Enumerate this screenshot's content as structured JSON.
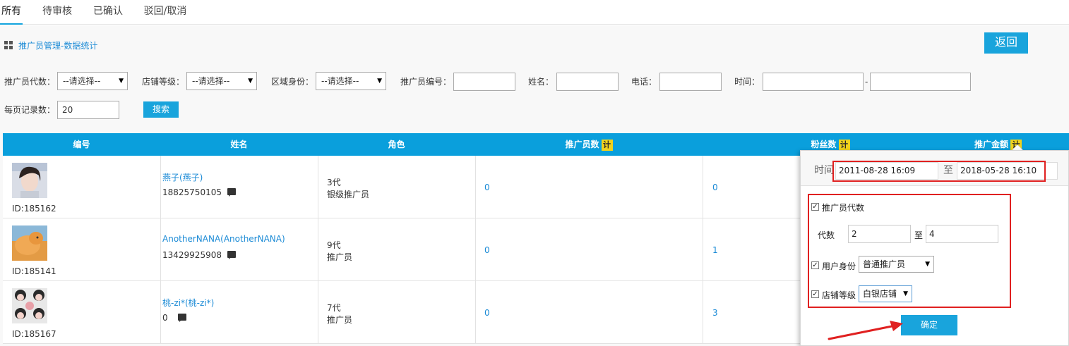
{
  "tabs": [
    {
      "label": "所有"
    },
    {
      "label": "待审核"
    },
    {
      "label": "已确认"
    },
    {
      "label": "驳回/取消"
    }
  ],
  "breadcrumb": "推广员管理-数据统计",
  "back_button": "返回",
  "filters": {
    "level_label": "推广员代数：",
    "level_value": "--请选择--",
    "shop_label": "店铺等级：",
    "shop_value": "--请选择--",
    "region_label": "区域身份：",
    "region_value": "--请选择--",
    "code_label": "推广员编号：",
    "name_label": "姓名：",
    "phone_label": "电话：",
    "time_label": "时间：",
    "time_dash": "-",
    "page_size_label": "每页记录数：",
    "page_size_value": "20",
    "search_button": "搜索"
  },
  "table": {
    "headers": [
      "编号",
      "姓名",
      "角色",
      "推广员数",
      "粉丝数",
      "推广金额"
    ],
    "calc_icon_glyph": "计",
    "rows": [
      {
        "id": "ID:185162",
        "name": "燕子(燕子)",
        "phone": "18825750105",
        "generation": "3代",
        "role": "银级推广员",
        "promoters": "0",
        "fans": "0"
      },
      {
        "id": "ID:185141",
        "name": "AnotherNANA(AnotherNANA)",
        "phone": "13429925908",
        "generation": "9代",
        "role": "推广员",
        "promoters": "0",
        "fans": "1"
      },
      {
        "id": "ID:185167",
        "name": "桃-zi*(桃-zi*)",
        "phone": "0",
        "generation": "7代",
        "role": "推广员",
        "promoters": "0",
        "fans": "3"
      }
    ]
  },
  "popup": {
    "time_label": "时间",
    "date_from": "2011-08-28 16:09",
    "date_sep": "至",
    "date_to": "2018-05-28 16:10",
    "gen_checkbox_label": "推广员代数",
    "gen_label": "代数",
    "gen_from": "2",
    "gen_sep": "至",
    "gen_to": "4",
    "identity_label": "用户身份",
    "identity_value": "普通推广员",
    "shop_label": "店铺等级",
    "shop_value": "白银店铺",
    "confirm_button": "确定"
  },
  "colors": {
    "accent": "#19a4dc",
    "header_bg": "#0a9fdc",
    "link": "#1c8bd6",
    "highlight_box": "#e02020",
    "calc_icon": "#f0d21c"
  },
  "icons": [
    "grid-icon",
    "chat-icon",
    "calc-icon",
    "dropdown-arrow-icon",
    "checkbox-icon",
    "red-arrow-annotation"
  ]
}
